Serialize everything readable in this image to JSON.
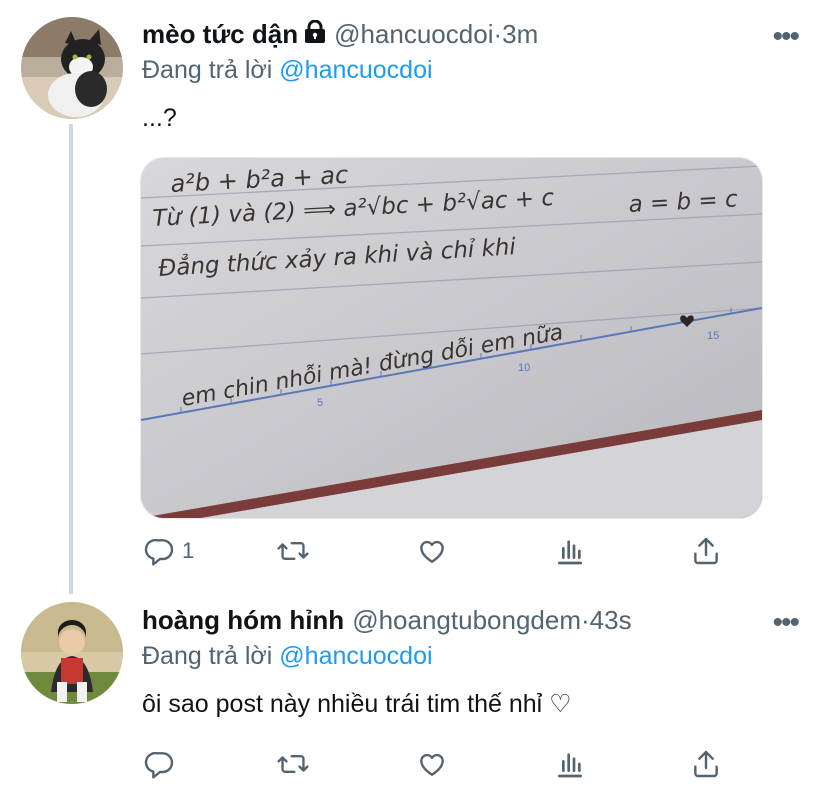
{
  "tweets": [
    {
      "name": "mèo tức dận",
      "handle": "@hancuocdoi",
      "time": "3m",
      "replying_prefix": "Đang trả lời ",
      "replying_to": "@hancuocdoi",
      "text": "...?",
      "reply_count": "1",
      "retweet_count": "",
      "like_count": "",
      "protected": true
    },
    {
      "name": "hoàng hóm hỉnh",
      "handle": "@hoangtubongdem",
      "time": "43s",
      "replying_prefix": "Đang trả lời ",
      "replying_to": "@hancuocdoi",
      "text": "ôi sao post này nhiều trái tim thế nhỉ ♡",
      "reply_count": "",
      "retweet_count": "",
      "like_count": "",
      "protected": false
    }
  ],
  "separator": " · ",
  "more_glyph": "•••",
  "handwriting": {
    "line1": "a²b + b²a + ac",
    "line2": "Từ (1) và (2) ⟹ a²√bc + b²√ac + c",
    "line2_right": "a = b = c",
    "line3": "Đẳng thức xảy ra khi và chỉ khi",
    "line4": "em chin nhỗi mà! đừng dỗi em nữa",
    "ruler_5": "5",
    "ruler_10": "10",
    "ruler_15": "15"
  },
  "icons": [
    "lock-icon",
    "more-icon",
    "reply-icon",
    "retweet-icon",
    "like-icon",
    "analytics-icon",
    "share-icon"
  ],
  "colors": {
    "link": "#1d9bf0",
    "secondary": "#536471",
    "primary": "#0f1419",
    "thread": "#cfd9de"
  }
}
